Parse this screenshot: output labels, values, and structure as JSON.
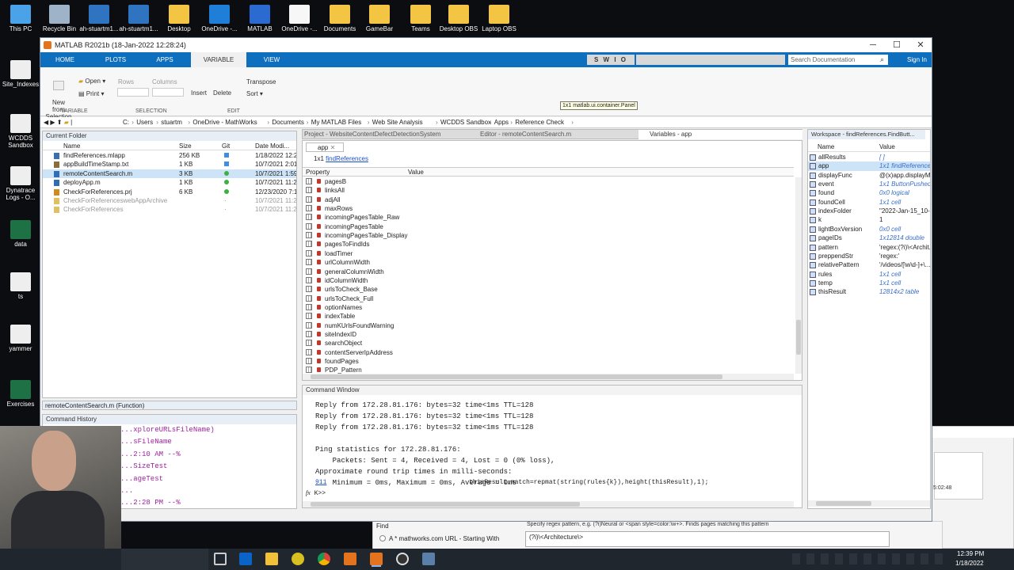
{
  "desktop": {
    "icons": [
      {
        "label": "This PC",
        "color": "#4aa3e8"
      },
      {
        "label": "Recycle Bin",
        "color": "#9fb3c8"
      },
      {
        "label": "ah-stuartm1...",
        "color": "#2f74c0"
      },
      {
        "label": "ah-stuartm1...",
        "color": "#2f74c0"
      },
      {
        "label": "Desktop",
        "color": "#f4c542"
      },
      {
        "label": "OneDrive -...",
        "color": "#1f7fd8"
      },
      {
        "label": "MATLAB",
        "color": "#2b6ad0"
      },
      {
        "label": "OneDrive -...",
        "color": "#f7f7f7"
      },
      {
        "label": "Documents",
        "color": "#f4c542"
      },
      {
        "label": "GameBar",
        "color": "#f4c542"
      },
      {
        "label": "Teams",
        "color": "#f4c542"
      },
      {
        "label": "Desktop OBS",
        "color": "#f4c542"
      },
      {
        "label": "Laptop OBS",
        "color": "#f4c542"
      }
    ],
    "left_icons": [
      {
        "label": "Site_Indexes",
        "color": "#eee"
      },
      {
        "label": "WCDDS Sandbox",
        "color": "#eee"
      },
      {
        "label": "Dynatrace Logs - O...",
        "color": "#eee"
      },
      {
        "label": "data",
        "color": "#1e7145"
      },
      {
        "label": "ts",
        "color": "#eee"
      },
      {
        "label": "yammer",
        "color": "#eee"
      },
      {
        "label": "Exercises",
        "color": "#1e7145"
      }
    ]
  },
  "window": {
    "title": "MATLAB R2021b (18-Jan-2022 12:28:24)",
    "min": "─",
    "max": "☐",
    "close": "✕"
  },
  "ribbon_tabs": [
    "HOME",
    "PLOTS",
    "APPS",
    "VARIABLE",
    "VIEW"
  ],
  "search": {
    "placeholder": "Search Documentation",
    "signin": "Sign In"
  },
  "quick_toolbar": "S W I O",
  "ribbon": {
    "new_from_selection": "New from\nSelection",
    "open": "Open",
    "print": "Print",
    "rows": "Rows",
    "columns": "Columns",
    "insert": "Insert",
    "delete": "Delete",
    "transpose": "Transpose",
    "sort": "Sort",
    "sections": [
      "VARIABLE",
      "SELECTION",
      "EDIT"
    ],
    "tooltip": "1x1 matlab.ui.container.Panel"
  },
  "address": [
    "C:",
    "Users",
    "stuartm",
    "OneDrive - MathWorks",
    "Documents",
    "My MATLAB Files",
    "Web Site Analysis",
    "WCDDS Sandbox",
    "Apps",
    "Reference Check"
  ],
  "current_folder": {
    "title": "Current Folder",
    "columns": [
      "Name",
      "Size",
      "Git",
      "Date Modi..."
    ],
    "files": [
      {
        "name": "findReferences.mlapp",
        "size": "256 KB",
        "git": "blue",
        "date": "1/18/2022 12:28...",
        "color": "#3a6fb0"
      },
      {
        "name": "appBuildTimeStamp.txt",
        "size": "1 KB",
        "git": "blue",
        "date": "10/7/2021 2:01...",
        "color": "#8a6d3b"
      },
      {
        "name": "remoteContentSearch.m",
        "size": "3 KB",
        "git": "green",
        "date": "10/7/2021 1:59...",
        "color": "#2f6db5"
      },
      {
        "name": "deployApp.m",
        "size": "1 KB",
        "git": "green",
        "date": "10/7/2021 11:2...",
        "color": "#2f6db5"
      },
      {
        "name": "CheckForReferences.prj",
        "size": "6 KB",
        "git": "green",
        "date": "12/23/2020 7:1...",
        "color": "#d08a1e"
      },
      {
        "name": "CheckForReferenceswebAppArchive",
        "size": "",
        "git": "dot",
        "date": "10/7/2021 11:2...",
        "color": "#e0c060"
      },
      {
        "name": "CheckForReferences",
        "size": "",
        "git": "dot",
        "date": "10/7/2021 11:2...",
        "color": "#e0c060"
      }
    ],
    "details": "remoteContentSearch.m  (Function)"
  },
  "command_history": {
    "title": "Command History",
    "lines": [
      "...xploreURLsFileName)",
      "...sFileName",
      "...2:10 AM --%",
      "...SizeTest",
      "...ageTest",
      "...",
      "...2:28 PM --%"
    ]
  },
  "editor_tabs": {
    "project": "Project - WebsiteContentDefectDetectionSystem",
    "editor": "Editor - remoteContentSearch.m",
    "variables": "Variables - app"
  },
  "variables": {
    "tab": "app",
    "size": "1x1",
    "name": "findReferences",
    "columns": [
      "Property",
      "Value"
    ],
    "props": [
      "pagesB",
      "linksAll",
      "adjAll",
      "maxRows",
      "incomingPagesTable_Raw",
      "incomingPagesTable",
      "incomingPagesTable_Display",
      "pagesToFindIds",
      "loadTimer",
      "urlColumnWidth",
      "generalColumnWidth",
      "idColumnWidth",
      "urlsToCheck_Base",
      "urlsToCheck_Full",
      "optionNames",
      "indexTable",
      "numKUrlsFoundWarning",
      "siteIndexID",
      "searchObject",
      "contentServerIpAddress",
      "foundPages",
      "PDP_Pattern"
    ]
  },
  "command_window": {
    "title": "Command Window",
    "lines": [
      "Reply from 172.28.81.176: bytes=32 time<1ms TTL=128",
      "Reply from 172.28.81.176: bytes=32 time<1ms TTL=128",
      "Reply from 172.28.81.176: bytes=32 time<1ms TTL=128",
      "",
      "Ping statistics for 172.28.81.176:",
      "    Packets: Sent = 4, Received = 4, Lost = 0 (0% loss),",
      "Approximate round trip times in milli-seconds:",
      "    Minimum = 0ms, Maximum = 0ms, Average = 0ms"
    ],
    "error_line_no": "911",
    "error_code": "thisResult.match=repmat(string(rules{k}),height(thisResult),1);",
    "prompt": "K>>"
  },
  "workspace": {
    "title": "Workspace - findReferences.FindButt...",
    "columns": [
      "Name",
      "Value"
    ],
    "vars": [
      {
        "name": "allResults",
        "value": "[ ]",
        "italic": true
      },
      {
        "name": "app",
        "value": "1x1 findReferences",
        "italic": true
      },
      {
        "name": "displayFunc",
        "value": "@(x)app.displayM...",
        "italic": false
      },
      {
        "name": "event",
        "value": "1x1 ButtonPushedE...",
        "italic": true
      },
      {
        "name": "found",
        "value": "0x0 logical",
        "italic": true
      },
      {
        "name": "foundCell",
        "value": "1x1 cell",
        "italic": true
      },
      {
        "name": "indexFolder",
        "value": "\"2022-Jan-15_10-1...",
        "italic": false
      },
      {
        "name": "k",
        "value": "1",
        "italic": false
      },
      {
        "name": "lightBoxVersion",
        "value": "0x0 cell",
        "italic": true
      },
      {
        "name": "pageIDs",
        "value": "1x12814 double",
        "italic": true
      },
      {
        "name": "pattern",
        "value": "'regex:(?i)\\<Archit...",
        "italic": false
      },
      {
        "name": "preppendStr",
        "value": "'regex:'",
        "italic": false
      },
      {
        "name": "relativePattern",
        "value": "'/videos/[\\w\\d-]+\\...",
        "italic": false
      },
      {
        "name": "rules",
        "value": "1x1 cell",
        "italic": true
      },
      {
        "name": "temp",
        "value": "1x1 cell",
        "italic": true
      },
      {
        "name": "thisResult",
        "value": "12814x2 table",
        "italic": true
      }
    ]
  },
  "background_app": {
    "find_label": "Find",
    "option1": "A * mathworks.com URL - Starting With",
    "hint": "Specify regex pattern, e.g. (?i)Neural or <span style=color:\\w+>. Finds pages matching this pattern",
    "pattern_value": "(?i)\\<Architecture\\>",
    "time_fragment": "5:02:48"
  },
  "taskbar": {
    "time": "12:39 PM",
    "date": "1/18/2022"
  }
}
